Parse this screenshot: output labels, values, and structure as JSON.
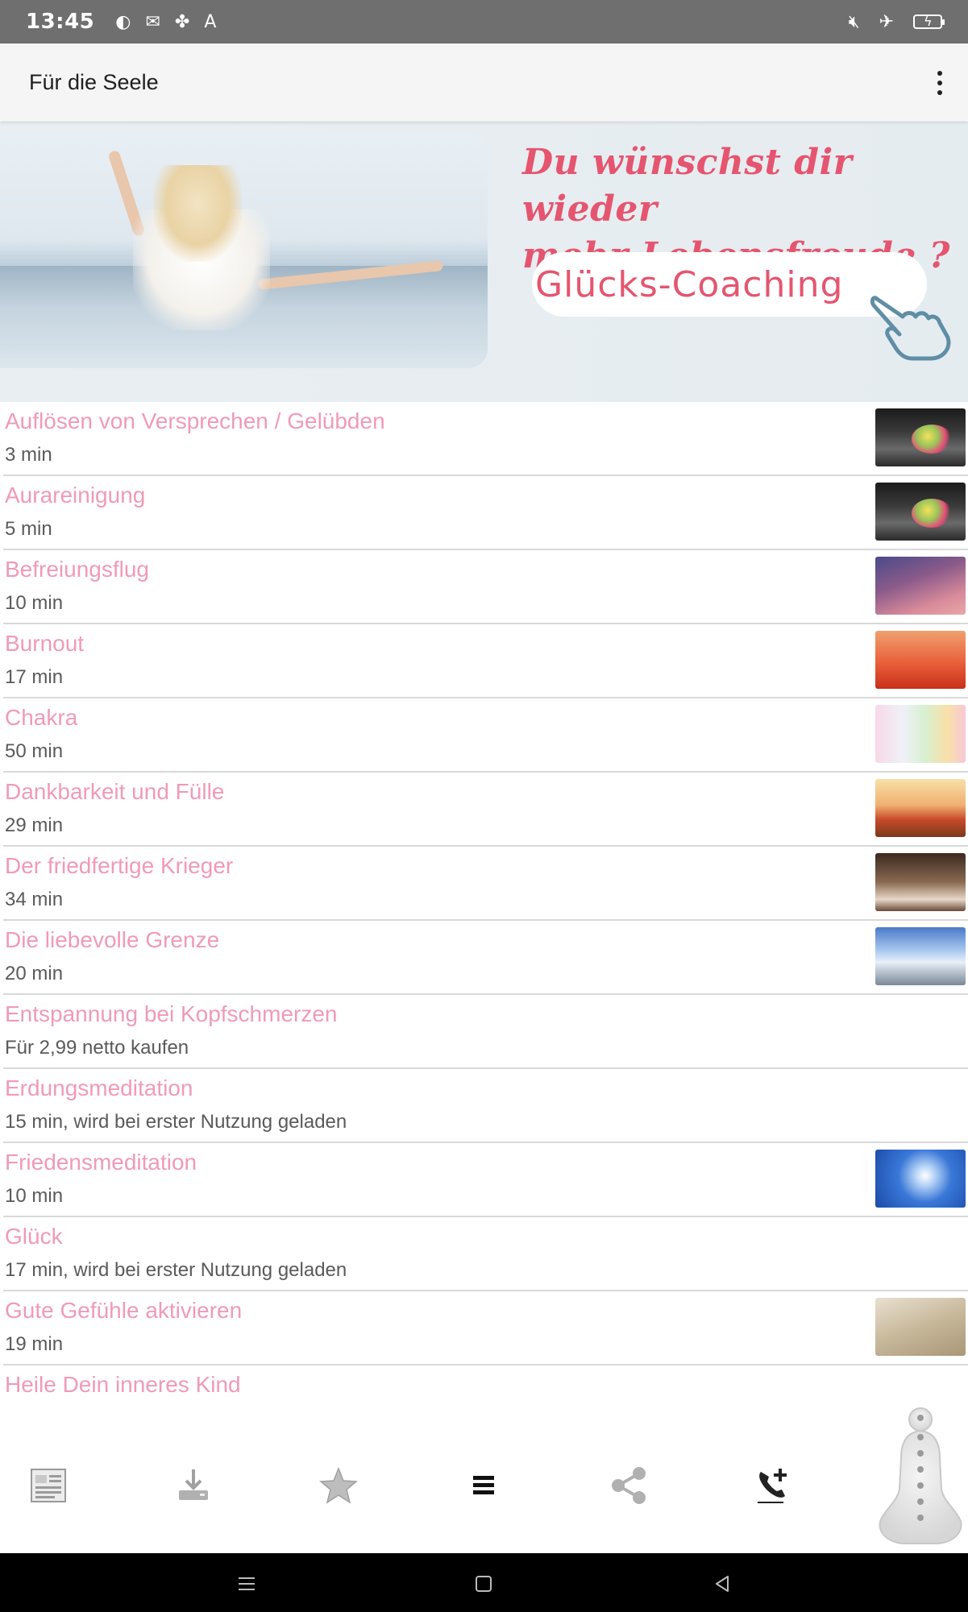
{
  "status_bar": {
    "time": "13:45"
  },
  "app_bar": {
    "title": "Für die Seele"
  },
  "banner": {
    "headline_line1": "Du wünschst dir wieder",
    "headline_line2": "mehr Lebensfreude ?",
    "cta_label": "Glücks-Coaching"
  },
  "list": {
    "items": [
      {
        "title": "Auflösen von Versprechen / Gelübden",
        "subtitle": "3 min",
        "thumb": "flowers"
      },
      {
        "title": "Aurareinigung",
        "subtitle": "5 min",
        "thumb": "flowers"
      },
      {
        "title": "Befreiungsflug",
        "subtitle": "10 min",
        "thumb": "sky"
      },
      {
        "title": "Burnout",
        "subtitle": "17 min",
        "thumb": "candles"
      },
      {
        "title": "Chakra",
        "subtitle": "50 min",
        "thumb": "chakra"
      },
      {
        "title": "Dankbarkeit und Fülle",
        "subtitle": "29 min",
        "thumb": "fruit"
      },
      {
        "title": "Der friedfertige Krieger",
        "subtitle": "34 min",
        "thumb": "dreamcatcher"
      },
      {
        "title": "Die liebevolle Grenze",
        "subtitle": "20 min",
        "thumb": "hearts"
      },
      {
        "title": "Entspannung bei Kopfschmerzen",
        "subtitle": "Für 2,99 netto kaufen",
        "thumb": ""
      },
      {
        "title": "Erdungsmeditation",
        "subtitle": "15 min, wird bei erster Nutzung geladen",
        "thumb": ""
      },
      {
        "title": "Friedensmeditation",
        "subtitle": "10 min",
        "thumb": "dove"
      },
      {
        "title": "Glück",
        "subtitle": "17 min, wird bei erster Nutzung geladen",
        "thumb": ""
      },
      {
        "title": "Gute Gefühle aktivieren",
        "subtitle": "19 min",
        "thumb": "woman"
      },
      {
        "title": "Heile Dein inneres Kind",
        "subtitle": "",
        "thumb": ""
      }
    ]
  },
  "bottom_nav": {
    "items": [
      {
        "name": "document-icon",
        "active": false
      },
      {
        "name": "download-icon",
        "active": false
      },
      {
        "name": "star-icon",
        "active": false
      },
      {
        "name": "list-icon",
        "active": true
      },
      {
        "name": "share-icon",
        "active": false
      },
      {
        "name": "add-call-icon",
        "active": false
      }
    ]
  },
  "colors": {
    "accent_pink": "#f09ab8",
    "banner_pink": "#e5556f",
    "subtitle_gray": "#5a5a5a",
    "inactive_icon": "#a8a8a8",
    "active_icon": "#111111"
  }
}
